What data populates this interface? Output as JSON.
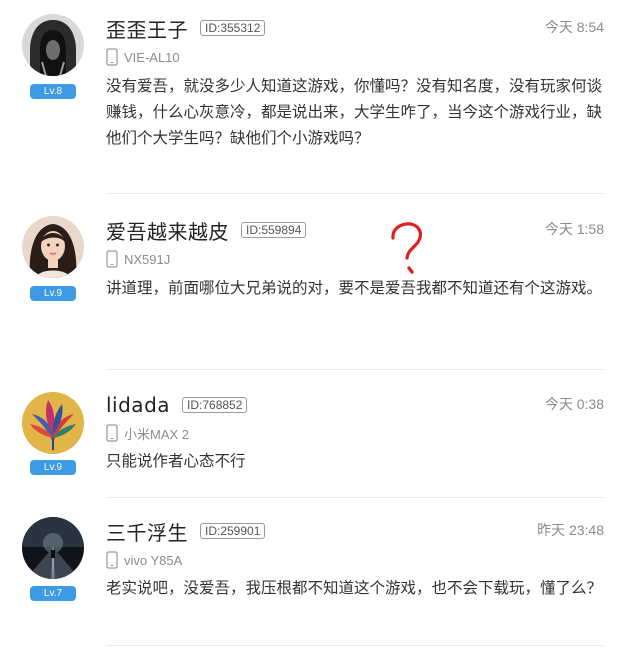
{
  "comments": [
    {
      "username": "歪歪王子",
      "uid": "ID:355312",
      "time": "今天 8:54",
      "device": "VIE-AL10",
      "level": "Lv.8",
      "text": "没有爱吾，就没多少人知道这游戏，你懂吗？没有知名度，没有玩家何谈赚钱，什么心灰意冷，都是说出来，大学生咋了，当今这个游戏行业，缺他们个大学生吗？缺他们个小游戏吗？",
      "avatar_icon": "hooded-figure-avatar"
    },
    {
      "username": "爱吾越来越皮",
      "uid": "ID:559894",
      "time": "今天 1:58",
      "device": "NX591J",
      "level": "Lv.9",
      "text": "讲道理，前面哪位大兄弟说的对，要不是爱吾我都不知道还有个这游戏。",
      "avatar_icon": "girl-portrait-avatar"
    },
    {
      "username": "lidada",
      "uid": "ID:768852",
      "time": "今天 0:38",
      "device": "小米MAX 2",
      "level": "Lv.9",
      "text": "只能说作者心态不行",
      "avatar_icon": "flower-avatar"
    },
    {
      "username": "三千浮生",
      "uid": "ID:259901",
      "time": "昨天 23:48",
      "device": "vivo Y85A",
      "level": "Lv.7",
      "text": "老实说吧，没爱吾，我压根都不知道这个游戏，也不会下载玩，懂了么？",
      "avatar_icon": "night-road-avatar"
    }
  ],
  "colors": {
    "level_badge": "#3d9be6",
    "annotation_red": "#e02020",
    "divider": "#ececec"
  }
}
